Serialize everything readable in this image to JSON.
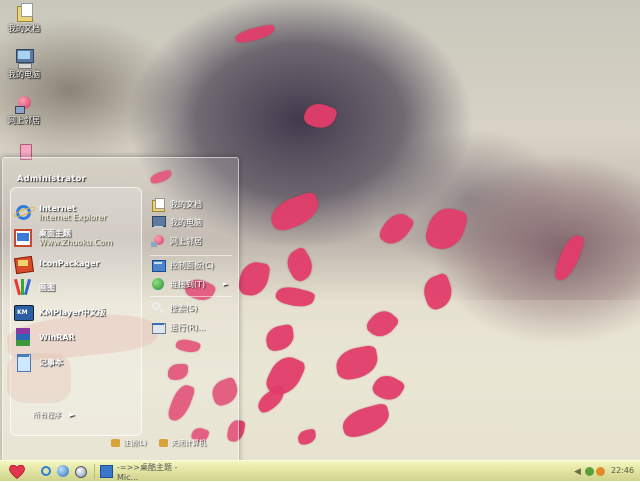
{
  "desktop": {
    "icons": [
      {
        "label": "我的文档",
        "icon": "my-documents-icon"
      },
      {
        "label": "我的电脑",
        "icon": "my-computer-icon"
      },
      {
        "label": "网上邻居",
        "icon": "network-places-icon"
      },
      {
        "label": "",
        "icon": "recycle-bin-icon"
      }
    ]
  },
  "start_menu": {
    "username": "Administrator",
    "programs": [
      {
        "title": "Internet",
        "subtitle": "Internet Explorer",
        "icon": "internet-explorer-icon"
      },
      {
        "title": "桌面主题",
        "subtitle": "Www.Zhuoku.Com",
        "icon": "desktop-theme-icon"
      },
      {
        "title": "IconPackager",
        "subtitle": "",
        "icon": "iconpackager-icon"
      },
      {
        "title": "画图",
        "subtitle": "",
        "icon": "paint-icon"
      },
      {
        "title": "KMPlayer中文版",
        "subtitle": "",
        "icon": "kmplayer-icon"
      },
      {
        "title": "WinRAR",
        "subtitle": "",
        "icon": "winrar-icon"
      },
      {
        "title": "记事本",
        "subtitle": "",
        "icon": "notepad-icon"
      }
    ],
    "all_programs_label": "所有程序",
    "places": [
      {
        "label": "我的文档",
        "icon": "my-documents-icon"
      },
      {
        "label": "我的电脑",
        "icon": "my-computer-icon"
      },
      {
        "label": "网上邻居",
        "icon": "network-places-icon"
      }
    ],
    "system": [
      {
        "label": "控制面板(C)",
        "icon": "control-panel-icon"
      },
      {
        "label": "连接到(T)",
        "icon": "connect-to-icon",
        "has_submenu": true
      },
      {
        "label": "搜索(S)",
        "icon": "search-icon"
      },
      {
        "label": "运行(R)...",
        "icon": "run-icon"
      }
    ],
    "logoff_label": "注销(L)",
    "shutdown_label": "关闭计算机"
  },
  "taskbar": {
    "quick_launch": [
      "internet-explorer-icon",
      "show-desktop-icon",
      "media-player-icon"
    ],
    "task_label": "-=>>桌酷主题 - Mic...",
    "clock": "22:46"
  },
  "colors": {
    "petal": "#e23d6a",
    "taskbar": "#e3e6a4"
  }
}
